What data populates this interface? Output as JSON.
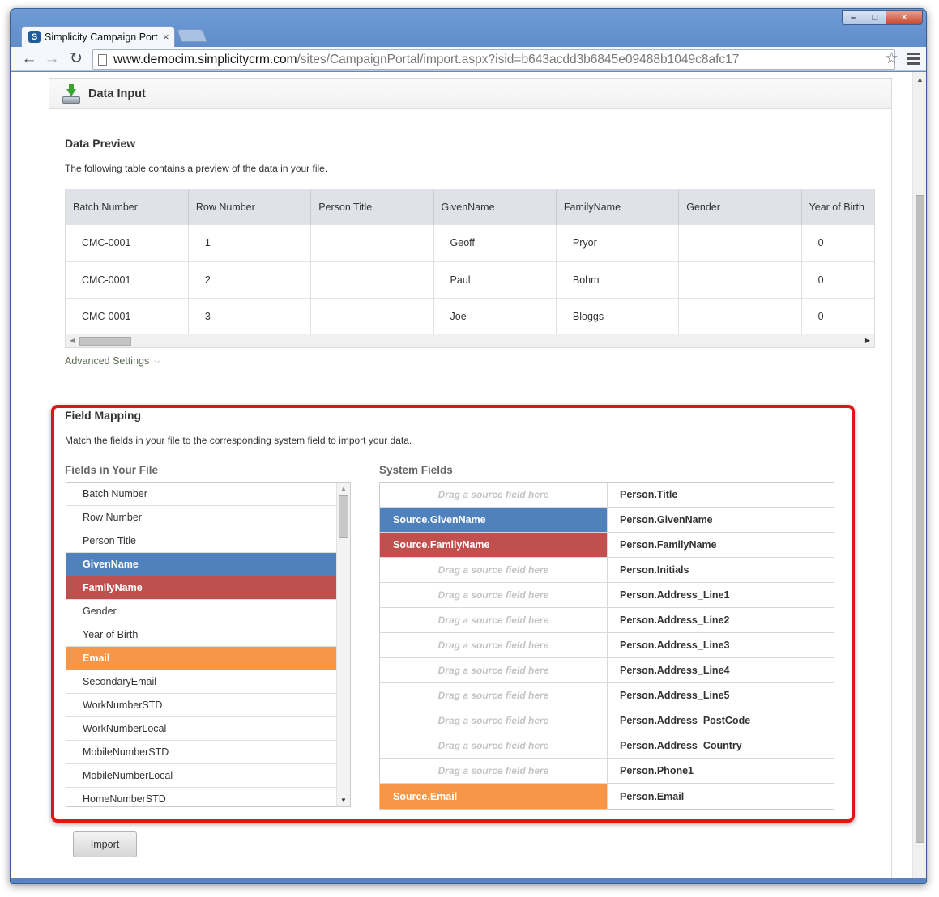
{
  "browser": {
    "tab_title": "Simplicity Campaign Portal",
    "tab_favicon": "S",
    "url_host": "www.democim.simplicitycrm.com",
    "url_path": "/sites/CampaignPortal/import.aspx?isid=b643acdd3b6845e09488b1049c8afc17"
  },
  "panel": {
    "title": "Data Input"
  },
  "preview": {
    "title": "Data Preview",
    "description": "The following table contains a preview of the data in your file.",
    "columns": [
      "Batch Number",
      "Row Number",
      "Person Title",
      "GivenName",
      "FamilyName",
      "Gender",
      "Year of Birth"
    ],
    "rows": [
      [
        "CMC-0001",
        "1",
        "",
        "Geoff",
        "Pryor",
        "",
        "0"
      ],
      [
        "CMC-0001",
        "2",
        "",
        "Paul",
        "Bohm",
        "",
        "0"
      ],
      [
        "CMC-0001",
        "3",
        "",
        "Joe",
        "Bloggs",
        "",
        "0"
      ]
    ]
  },
  "advanced_settings": "Advanced Settings",
  "mapping": {
    "title": "Field Mapping",
    "description": "Match the fields in your file to the corresponding system field to import your data.",
    "file_fields_title": "Fields in Your File",
    "system_fields_title": "System Fields",
    "file_fields": [
      {
        "label": "Batch Number",
        "color": ""
      },
      {
        "label": "Row Number",
        "color": ""
      },
      {
        "label": "Person Title",
        "color": ""
      },
      {
        "label": "GivenName",
        "color": "blue"
      },
      {
        "label": "FamilyName",
        "color": "red"
      },
      {
        "label": "Gender",
        "color": ""
      },
      {
        "label": "Year of Birth",
        "color": ""
      },
      {
        "label": "Email",
        "color": "orange"
      },
      {
        "label": "SecondaryEmail",
        "color": ""
      },
      {
        "label": "WorkNumberSTD",
        "color": ""
      },
      {
        "label": "WorkNumberLocal",
        "color": ""
      },
      {
        "label": "MobileNumberSTD",
        "color": ""
      },
      {
        "label": "MobileNumberLocal",
        "color": ""
      },
      {
        "label": "HomeNumberSTD",
        "color": ""
      }
    ],
    "drop_placeholder": "Drag a source field here",
    "system_fields": [
      {
        "source": "",
        "field": "Person.Title",
        "color": ""
      },
      {
        "source": "Source.GivenName",
        "field": "Person.GivenName",
        "color": "blue"
      },
      {
        "source": "Source.FamilyName",
        "field": "Person.FamilyName",
        "color": "red"
      },
      {
        "source": "",
        "field": "Person.Initials",
        "color": ""
      },
      {
        "source": "",
        "field": "Person.Address_Line1",
        "color": ""
      },
      {
        "source": "",
        "field": "Person.Address_Line2",
        "color": ""
      },
      {
        "source": "",
        "field": "Person.Address_Line3",
        "color": ""
      },
      {
        "source": "",
        "field": "Person.Address_Line4",
        "color": ""
      },
      {
        "source": "",
        "field": "Person.Address_Line5",
        "color": ""
      },
      {
        "source": "",
        "field": "Person.Address_PostCode",
        "color": ""
      },
      {
        "source": "",
        "field": "Person.Address_Country",
        "color": ""
      },
      {
        "source": "",
        "field": "Person.Phone1",
        "color": ""
      },
      {
        "source": "Source.Email",
        "field": "Person.Email",
        "color": "orange"
      }
    ]
  },
  "import_button": "Import",
  "colors": {
    "blue": "#4f81bd",
    "red": "#c0504d",
    "orange": "#f79646",
    "highlight": "#e51414"
  }
}
